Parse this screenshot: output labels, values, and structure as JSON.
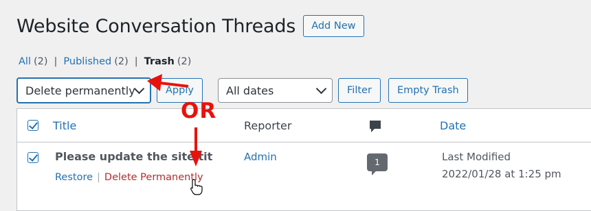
{
  "header": {
    "title": "Website Conversation Threads",
    "add_new_label": "Add New"
  },
  "views": {
    "all": {
      "label": "All",
      "count": "(2)"
    },
    "published": {
      "label": "Published",
      "count": "(2)"
    },
    "trash": {
      "label": "Trash",
      "count": "(2)"
    },
    "separator": "|"
  },
  "toolbar": {
    "bulk_action_selected": "Delete permanently",
    "apply_label": "Apply",
    "date_filter_selected": "All dates",
    "filter_label": "Filter",
    "empty_trash_label": "Empty Trash"
  },
  "table": {
    "columns": {
      "title": "Title",
      "reporter": "Reporter",
      "comments_icon": "comment-bubble-icon",
      "date": "Date"
    },
    "rows": [
      {
        "checked": true,
        "title": "Please update the site tit",
        "actions": {
          "restore": "Restore",
          "separator": "|",
          "delete": "Delete Permanently"
        },
        "reporter": "Admin",
        "comments": "1",
        "date_status": "Last Modified",
        "date": "2022/01/28 at 1:25 pm"
      }
    ]
  },
  "annotations": {
    "or_text": "OR",
    "color": "#e8120c"
  },
  "colors": {
    "accent": "#2271b1",
    "delete": "#b32d2e",
    "background": "#f0f0f1"
  }
}
